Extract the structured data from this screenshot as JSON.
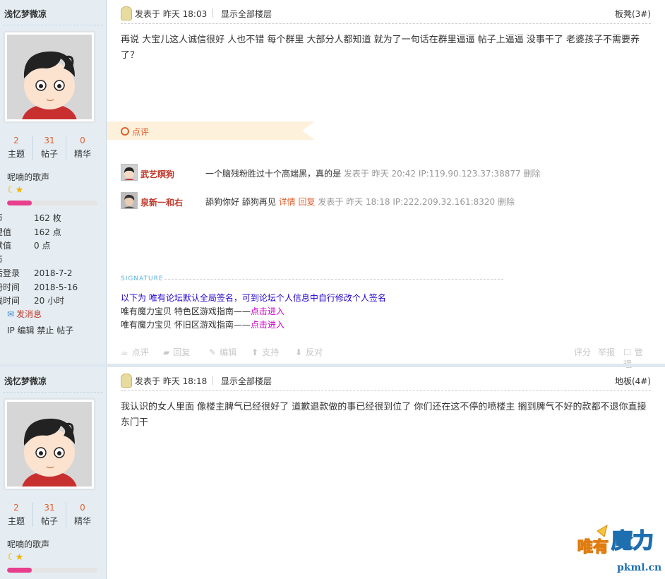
{
  "post1": {
    "author": "浅忆梦微凉",
    "stats": [
      {
        "num": "2",
        "label": "主题"
      },
      {
        "num": "31",
        "label": "帖子"
      },
      {
        "num": "0",
        "label": "精华"
      }
    ],
    "group": "呢喃的歌声",
    "progress": 0.27,
    "info": [
      {
        "k": "币",
        "v": "162 枚"
      },
      {
        "k": "望值",
        "v": "162 点"
      },
      {
        "k": "献值",
        "v": "0 点"
      },
      {
        "k": "币",
        "v": ""
      },
      {
        "k": "后登录",
        "v": "2018-7-2"
      },
      {
        "k": "册时间",
        "v": "2018-5-16"
      },
      {
        "k": "线时间",
        "v": "20 小时"
      }
    ],
    "send_msg": "发消息",
    "ops": "IP 编辑 禁止 帖子",
    "posted": "发表于  昨天 18:03",
    "show_all": "显示全部楼层",
    "floor": "板凳(3#)",
    "content": "再说 大宝儿这人诚信很好 人也不错  每个群里 大部分人都知道 就为了一句话在群里逼逼 帖子上逼逼 没事干了 老婆孩子不需要养了？",
    "dianping_label": "点评",
    "comments": [
      {
        "name": "武艺瞑狗",
        "text": "一个脑残粉胜过十个高端黑，真的是",
        "extra": "",
        "meta": "发表于  昨天 20:42 IP:119.90.123.37:38877 删除"
      },
      {
        "name": "泉新一和右",
        "text": "舔狗你好  舔狗再见",
        "extra": "详情 回复",
        "meta": "发表于  昨天 18:18 IP:222.209.32.161:8320 删除"
      }
    ],
    "signature_label": "SIGNATURE",
    "sig_line1": "以下为  唯有论坛默认全局签名，可到论坛个人信息中自行修改个人签名",
    "sig_line2": "唯有魔力宝贝  特色区游戏指南——",
    "sig_line3": "唯有魔力宝贝  怀旧区游戏指南——",
    "sig_link": "点击进入",
    "actions": {
      "dianping": "点评",
      "reply": "回复",
      "edit": "编辑",
      "support": "支持",
      "oppose": "反对",
      "rate": "评分",
      "report": "举报",
      "manage": "管理"
    }
  },
  "post2": {
    "author": "浅忆梦微凉",
    "stats": [
      {
        "num": "2",
        "label": "主题"
      },
      {
        "num": "31",
        "label": "帖子"
      },
      {
        "num": "0",
        "label": "精华"
      }
    ],
    "group": "呢喃的歌声",
    "progress": 0.27,
    "posted": "发表于  昨天 18:18",
    "show_all": "显示全部楼层",
    "floor": "地板(4#)",
    "content": "我认识的女人里面 像楼主脾气已经很好了 道歉退款做的事已经很到位了 你们还在这不停的喷楼主 搁到脾气不好的款都不退你直接东门干"
  },
  "watermark": {
    "text1": "唯有",
    "text2": "魔力",
    "url": "pkml.cn"
  },
  "colors": {
    "accent": "#e06030",
    "sidebar": "#e5edf2",
    "link": "#cc00cc",
    "sig_blue": "#2200cc"
  }
}
